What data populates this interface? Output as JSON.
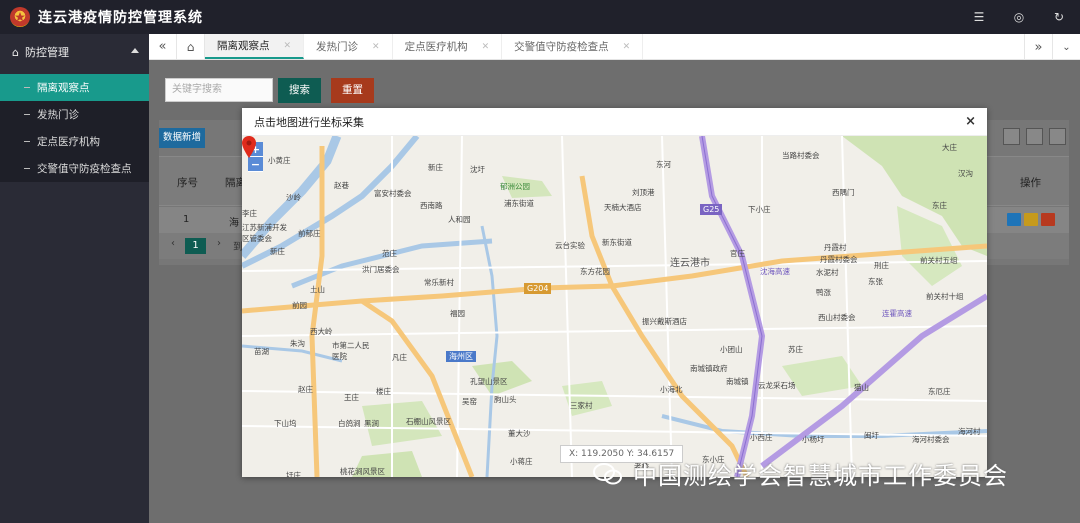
{
  "header": {
    "title": "连云港疫情防控管理系统",
    "icons": [
      "list-icon",
      "globe-icon",
      "refresh-icon"
    ]
  },
  "sidebar": {
    "section": "防控管理",
    "items": [
      {
        "label": "隔离观察点",
        "active": true
      },
      {
        "label": "发热门诊",
        "active": false
      },
      {
        "label": "定点医疗机构",
        "active": false
      },
      {
        "label": "交警值守防疫检查点",
        "active": false
      }
    ]
  },
  "tabs": [
    {
      "label": "隔离观察点",
      "active": true
    },
    {
      "label": "发热门诊",
      "active": false
    },
    {
      "label": "定点医疗机构",
      "active": false
    },
    {
      "label": "交警值守防疫检查点",
      "active": false
    }
  ],
  "toolbar": {
    "search_placeholder": "关键字搜索",
    "search_label": "搜索",
    "reset_label": "重置",
    "add_label": "数据新增"
  },
  "table": {
    "headers": [
      "序号",
      "隔离",
      "操作"
    ],
    "rows": [
      {
        "index": "1",
        "name": "海"
      }
    ]
  },
  "pager": {
    "current": "1",
    "goto": "到"
  },
  "modal": {
    "title": "点击地图进行坐标采集",
    "close": "×",
    "zoom_in": "+",
    "zoom_out": "−",
    "coord_text": "X: 119.2050  Y: 34.6157",
    "map_labels": {
      "city": "连云港市",
      "district": "海州区",
      "park": "郁洲公园",
      "hotel1": "天楠大酒店",
      "hotel2": "振兴戴斯酒店",
      "hospital": "市第二人民医院",
      "places": [
        "小黄庄",
        "赵巷",
        "新庄",
        "沈圩",
        "东河",
        "当路村委会",
        "汉沟",
        "富安村委会",
        "西南路",
        "浦东街道",
        "刘顶港",
        "西隅门",
        "李庄",
        "江苏新浦开发区管委会",
        "人和园",
        "云台实验",
        "新东街道",
        "前郁庄",
        "沙岭",
        "新庄",
        "范庄",
        "洪门居委会",
        "常乐新村",
        "东方花园",
        "官庄",
        "丹霞村",
        "丹霞村委会",
        "水泥村",
        "东张",
        "刑庄",
        "前关村五组",
        "前关村十组",
        "鸭涨",
        "西山村委会",
        "土山",
        "福园",
        "前园",
        "西大岭",
        "朱沟",
        "苗湖",
        "凡庄",
        "孔望山景区",
        "小团山",
        "苏庄",
        "南城镇政府",
        "南城镇",
        "云龙采石场",
        "小海北",
        "赵庄",
        "王庄",
        "楼庄",
        "吴窑",
        "朐山头",
        "三家村",
        "猫山",
        "东厄庄",
        "下山坞",
        "白鸽涧",
        "黑涧",
        "石棚山风景区",
        "董大沙",
        "小西庄",
        "小杨圩",
        "海河村委会",
        "海河村",
        "闽圩",
        "东小庄",
        "桃花涧风景区",
        "圩庄",
        "小蒋庄",
        "下小庄",
        "老桥",
        "大庄",
        "东庄"
      ],
      "roads": [
        "G25",
        "G204",
        "连霍高速",
        "沈海高速"
      ]
    }
  },
  "watermark": "中国测绘学会智慧城市工作委员会",
  "colors": {
    "primary": "#189a8c",
    "reset": "#a73a1c",
    "add": "#1e6a9e",
    "topbar": "#20212b",
    "sidebar": "#2a2b36"
  }
}
